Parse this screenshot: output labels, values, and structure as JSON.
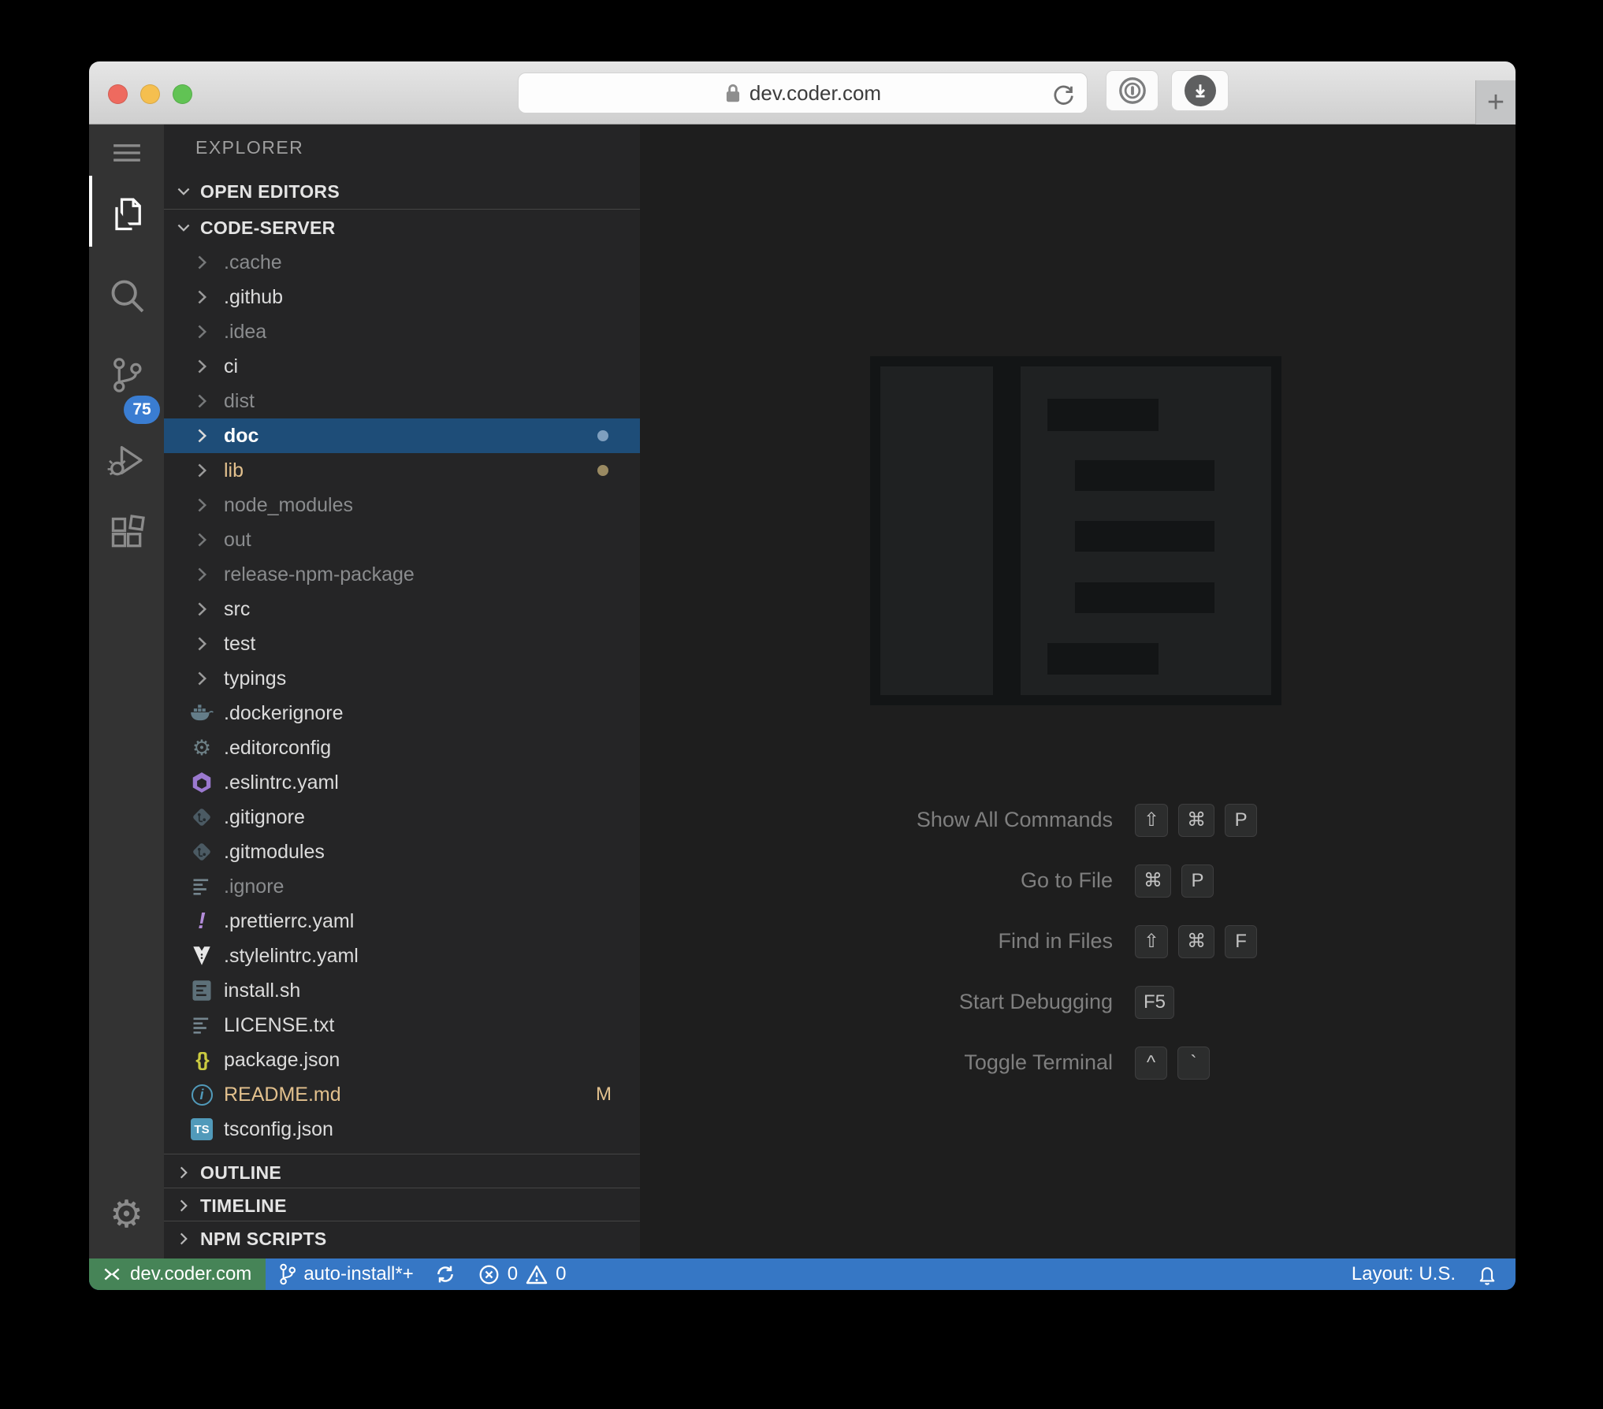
{
  "browser": {
    "url": "dev.coder.com",
    "new_tab_label": "+",
    "buttons": [
      "one-password",
      "download"
    ]
  },
  "activity_bar": {
    "items": [
      {
        "icon": "menu-icon",
        "active": false,
        "badge": null
      },
      {
        "icon": "files-icon",
        "active": true,
        "badge": null
      },
      {
        "icon": "search-icon",
        "active": false,
        "badge": null
      },
      {
        "icon": "source-control-icon",
        "active": false,
        "badge": "75"
      },
      {
        "icon": "run-debug-icon",
        "active": false,
        "badge": null
      },
      {
        "icon": "extensions-icon",
        "active": false,
        "badge": null
      }
    ],
    "settings_icon": "gear-icon"
  },
  "explorer": {
    "title": "EXPLORER",
    "open_editors_label": "OPEN EDITORS",
    "root_label": "CODE-SERVER",
    "outline_label": "OUTLINE",
    "timeline_label": "TIMELINE",
    "npm_scripts_label": "NPM SCRIPTS",
    "tree": [
      {
        "name": ".cache",
        "kind": "folder",
        "state": "dimmed"
      },
      {
        "name": ".github",
        "kind": "folder",
        "state": "normal"
      },
      {
        "name": ".idea",
        "kind": "folder",
        "state": "dimmed"
      },
      {
        "name": "ci",
        "kind": "folder",
        "state": "normal"
      },
      {
        "name": "dist",
        "kind": "folder",
        "state": "dimmed"
      },
      {
        "name": "doc",
        "kind": "folder",
        "state": "selected",
        "dot": "#7f9fbe"
      },
      {
        "name": "lib",
        "kind": "folder",
        "state": "modified",
        "dot": "#9a8a62"
      },
      {
        "name": "node_modules",
        "kind": "folder",
        "state": "dimmed"
      },
      {
        "name": "out",
        "kind": "folder",
        "state": "dimmed"
      },
      {
        "name": "release-npm-package",
        "kind": "folder",
        "state": "dimmed"
      },
      {
        "name": "src",
        "kind": "folder",
        "state": "normal"
      },
      {
        "name": "test",
        "kind": "folder",
        "state": "normal"
      },
      {
        "name": "typings",
        "kind": "folder",
        "state": "normal"
      },
      {
        "name": ".dockerignore",
        "kind": "file",
        "icon": "docker-icon",
        "state": "normal"
      },
      {
        "name": ".editorconfig",
        "kind": "file",
        "icon": "editorconfig-gear-icon",
        "state": "normal"
      },
      {
        "name": ".eslintrc.yaml",
        "kind": "file",
        "icon": "eslint-icon",
        "state": "normal"
      },
      {
        "name": ".gitignore",
        "kind": "file",
        "icon": "git-icon",
        "state": "normal"
      },
      {
        "name": ".gitmodules",
        "kind": "file",
        "icon": "git-icon",
        "state": "normal"
      },
      {
        "name": ".ignore",
        "kind": "file",
        "icon": "text-lines-icon",
        "state": "dimmed"
      },
      {
        "name": ".prettierrc.yaml",
        "kind": "file",
        "icon": "prettier-icon",
        "state": "normal"
      },
      {
        "name": ".stylelintrc.yaml",
        "kind": "file",
        "icon": "stylelint-icon",
        "state": "normal"
      },
      {
        "name": "install.sh",
        "kind": "file",
        "icon": "shell-script-icon",
        "state": "normal"
      },
      {
        "name": "LICENSE.txt",
        "kind": "file",
        "icon": "text-lines-icon",
        "state": "normal"
      },
      {
        "name": "package.json",
        "kind": "file",
        "icon": "json-braces-icon",
        "state": "normal"
      },
      {
        "name": "README.md",
        "kind": "file",
        "icon": "info-icon",
        "state": "modified",
        "badge": "M"
      },
      {
        "name": "tsconfig.json",
        "kind": "file",
        "icon": "typescript-icon",
        "state": "normal"
      }
    ]
  },
  "watermark": {
    "shortcuts": [
      {
        "label": "Show All Commands",
        "keys": [
          "⇧",
          "⌘",
          "P"
        ]
      },
      {
        "label": "Go to File",
        "keys": [
          "⌘",
          "P"
        ]
      },
      {
        "label": "Find in Files",
        "keys": [
          "⇧",
          "⌘",
          "F"
        ]
      },
      {
        "label": "Start Debugging",
        "keys": [
          "F5"
        ]
      },
      {
        "label": "Toggle Terminal",
        "keys": [
          "^",
          "`"
        ]
      }
    ]
  },
  "status_bar": {
    "remote": "dev.coder.com",
    "branch": "auto-install*+",
    "errors": "0",
    "warnings": "0",
    "layout": "Layout: U.S."
  },
  "colors": {
    "selection": "#1e4d78",
    "badge": "#3a7dd2",
    "status_bar": "#3677c5",
    "remote_background": "#468457",
    "git_modified": "#e2c08d",
    "sidebar": "#252526",
    "activity_bar": "#333333",
    "editor": "#1e1e1e"
  }
}
